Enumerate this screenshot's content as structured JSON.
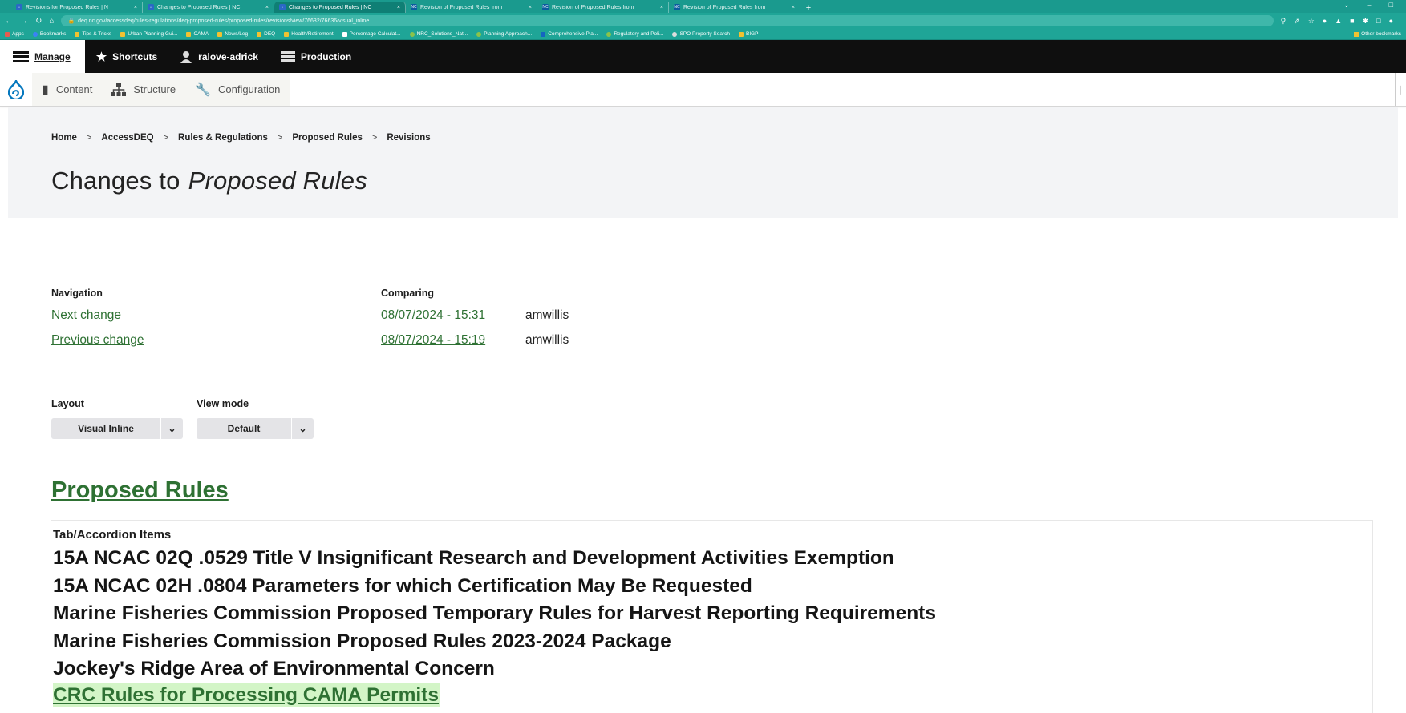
{
  "browser": {
    "tabs": [
      {
        "title": "Revisions for Proposed Rules | N",
        "fav": "↕",
        "active": false
      },
      {
        "title": "Changes to Proposed Rules | NC",
        "fav": "↕",
        "active": false
      },
      {
        "title": "Changes to Proposed Rules | NC",
        "fav": "↕",
        "active": true
      },
      {
        "title": "Revision of Proposed Rules from",
        "fav": "NC",
        "active": false
      },
      {
        "title": "Revision of Proposed Rules from",
        "fav": "NC",
        "active": false
      },
      {
        "title": "Revision of Proposed Rules from",
        "fav": "NC",
        "active": false
      }
    ],
    "tab_close": "×",
    "new_tab": "+",
    "url": "deq.nc.gov/accessdeq/rules-regulations/deq-proposed-rules/proposed-rules/revisions/view/76632/76636/visual_inline",
    "bookmarks": [
      "Apps",
      "Bookmarks",
      "Tips & Tricks",
      "Urban Planning Gui...",
      "CAMA",
      "News/Leg",
      "DEQ",
      "Health/Retirement",
      "Percentage Calculat...",
      "NRC_Solutions_Nat...",
      "Planning Approach...",
      "Comprehensive Pla...",
      "Regulatory and Poli...",
      "SPO Property Search",
      "BIGP"
    ],
    "other_bookmarks": "Other bookmarks"
  },
  "toolbar": {
    "manage": "Manage",
    "shortcuts": "Shortcuts",
    "user": "ralove-adrick",
    "environment": "Production"
  },
  "tray": {
    "content": "Content",
    "structure": "Structure",
    "configuration": "Configuration"
  },
  "breadcrumb": [
    "Home",
    "AccessDEQ",
    "Rules & Regulations",
    "Proposed Rules",
    "Revisions"
  ],
  "breadcrumb_sep": ">",
  "page_title": {
    "prefix": "Changes to",
    "emphasis": "Proposed Rules"
  },
  "diff_nav": {
    "navigation_label": "Navigation",
    "comparing_label": "Comparing",
    "next": "Next change",
    "previous": "Previous change",
    "revisions": [
      {
        "date": "08/07/2024 - 15:31",
        "author": "amwillis"
      },
      {
        "date": "08/07/2024 - 15:19",
        "author": "amwillis"
      }
    ]
  },
  "filters": {
    "layout_label": "Layout",
    "layout_value": "Visual Inline",
    "view_mode_label": "View mode",
    "view_mode_value": "Default"
  },
  "section_title": "Proposed Rules",
  "diff": {
    "field_label": "Tab/Accordion Items",
    "items": [
      "15A NCAC 02Q .0529 Title V Insignificant Research and Development Activities Exemption",
      "15A NCAC 02H .0804 Parameters for which Certification May Be Requested",
      "Marine Fisheries Commission Proposed Temporary Rules for Harvest Reporting Requirements",
      "Marine Fisheries Commission Proposed Rules 2023-2024 Package",
      "Jockey's Ridge Area of Environmental Concern"
    ],
    "added_item": "CRC Rules for Processing CAMA Permits"
  },
  "colors": {
    "link_green": "#2e7133",
    "added_highlight": "#d3f5c7",
    "browser_teal": "#1fa597",
    "drupal_blue": "#0678be"
  }
}
